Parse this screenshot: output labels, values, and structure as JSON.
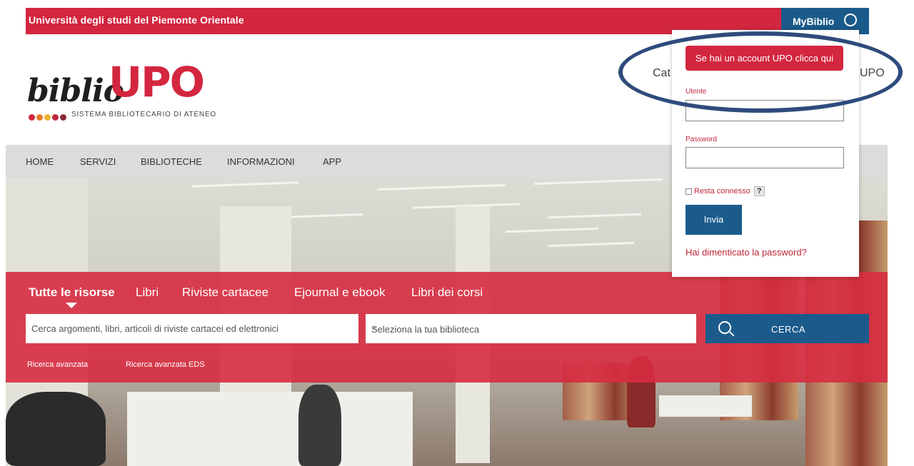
{
  "topbar": {
    "university": "Università degli studi del Piemonte Orientale",
    "mybiblio_label": "MyBiblio"
  },
  "logo": {
    "biblio": "biblio",
    "upo": "UPO",
    "subtitle": "SISTEMA BIBLIOTECARIO DI ATENEO",
    "dot_colors": [
      "#d3263f",
      "#e8782a",
      "#f0b12a",
      "#c0263a",
      "#8c2a3a"
    ]
  },
  "header": {
    "partial_left": "Cat",
    "partial_right": "UPO"
  },
  "nav": {
    "items": [
      "HOME",
      "SERVIZI",
      "BIBLIOTECHE",
      "INFORMAZIONI",
      "APP"
    ]
  },
  "search": {
    "tabs": [
      "Tutte le risorse",
      "Libri",
      "Riviste cartacee",
      "Ejournal e ebook",
      "Libri dei corsi"
    ],
    "active_tab": "Tutte le risorse",
    "input_placeholder": "Cerca argomenti, libri, articoli di riviste cartacei ed elettronici",
    "library_select": "Seleziona la tua biblioteca",
    "search_button": "CERCA",
    "advanced_links": [
      "Ricerca avanzata",
      "Ricerca avanzata EDS"
    ]
  },
  "login": {
    "upo_account_button": "Se hai un account UPO clicca qui",
    "user_label": "Utente",
    "password_label": "Password",
    "remember_label": "Resta connesso",
    "help_label": "?",
    "submit_button": "Invia",
    "forgot_link": "Hai dimenticato la password?"
  },
  "colors": {
    "brand_red": "#d3263f",
    "brand_blue": "#1b5b8c",
    "annotation": "#2e4b7c"
  }
}
